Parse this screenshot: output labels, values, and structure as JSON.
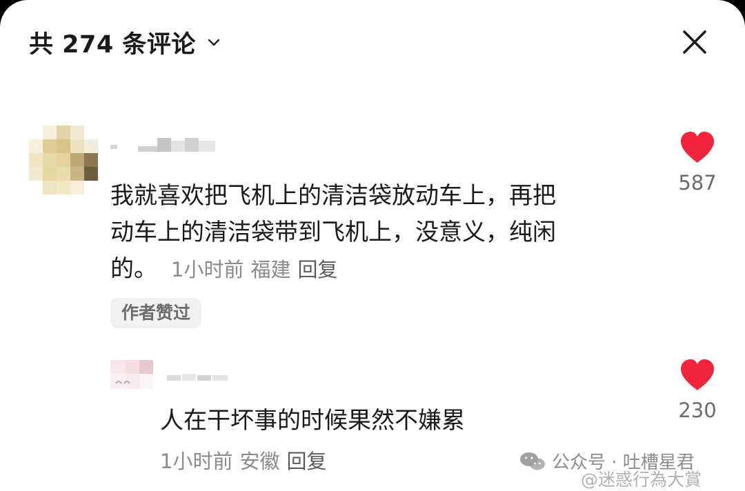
{
  "header": {
    "title": "共 274 条评论"
  },
  "comments": [
    {
      "text_line1": "我就喜欢把飞机上的清洁袋放动车上，再把",
      "text_line2": "动车上的清洁袋带到飞机上，没意义，纯闲",
      "text_line3": "的。",
      "time": "1小时前",
      "location": "福建",
      "reply_label": "回复",
      "badge": "作者赞过",
      "likes": "587"
    }
  ],
  "replies": [
    {
      "text": "人在干坏事的时候果然不嫌累",
      "time": "1小时前",
      "location": "安徽",
      "reply_label": "回复",
      "likes": "230"
    }
  ],
  "watermark": {
    "line1": "公众号 · 吐槽星君",
    "line2": "@迷惑行為大賞"
  },
  "colors": {
    "heart": "#f0243a",
    "text": "#1a1a1a",
    "meta": "#8a8a8a",
    "badge_bg": "#f1f1f1"
  },
  "icons": {
    "dropdown": "chevron-down-icon",
    "close": "close-icon",
    "like": "heart-icon",
    "watermark": "wechat-icon"
  }
}
